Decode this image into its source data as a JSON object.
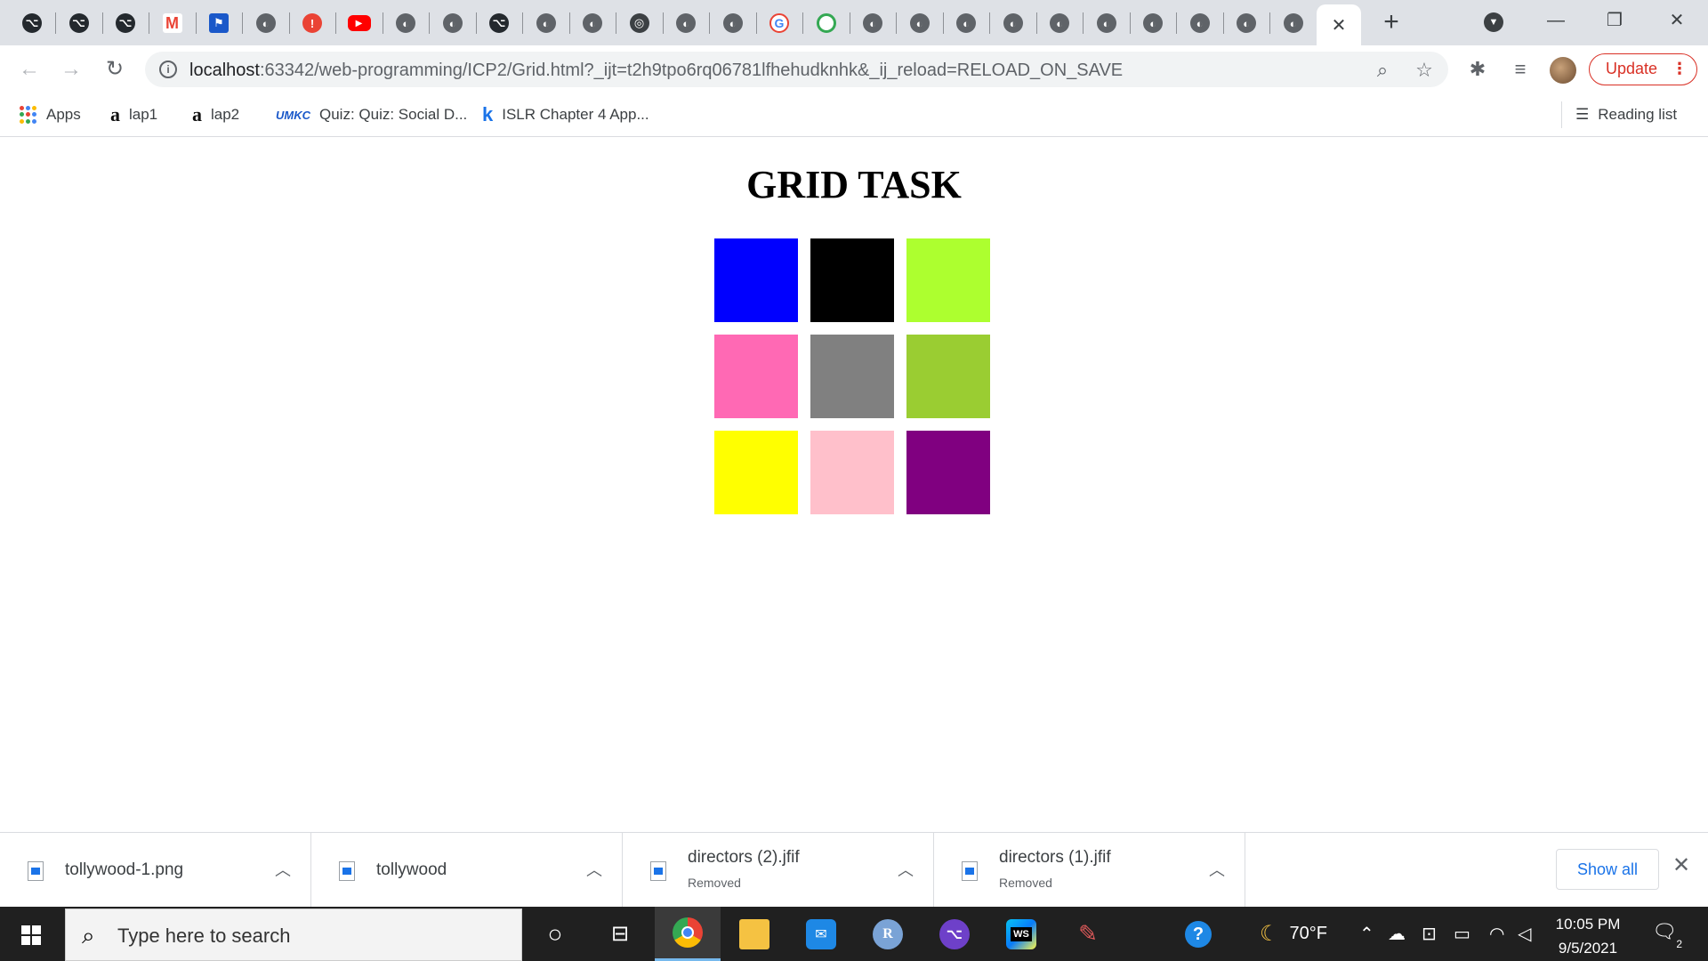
{
  "browser": {
    "tabs": [
      {
        "icon": "github-icon",
        "glyph": "⌥"
      },
      {
        "icon": "github-icon",
        "glyph": "⌥"
      },
      {
        "icon": "github-icon",
        "glyph": "⌥"
      },
      {
        "icon": "gmail-icon",
        "glyph": "M"
      },
      {
        "icon": "flag-icon",
        "glyph": "⚑"
      },
      {
        "icon": "globe-icon",
        "glyph": "◐"
      },
      {
        "icon": "alert-icon",
        "glyph": "!"
      },
      {
        "icon": "youtube-icon",
        "glyph": "▶"
      },
      {
        "icon": "globe-icon",
        "glyph": "◐"
      },
      {
        "icon": "globe-icon",
        "glyph": "◐"
      },
      {
        "icon": "github-icon",
        "glyph": "⌥"
      },
      {
        "icon": "globe-icon",
        "glyph": "◐"
      },
      {
        "icon": "globe-icon",
        "glyph": "◐"
      },
      {
        "icon": "chromium-icon",
        "glyph": "◎"
      },
      {
        "icon": "globe-icon",
        "glyph": "◐"
      },
      {
        "icon": "globe-icon",
        "glyph": "◐"
      },
      {
        "icon": "google-icon",
        "glyph": "G"
      },
      {
        "icon": "google-meet-icon",
        "glyph": ""
      },
      {
        "icon": "globe-icon",
        "glyph": "◐"
      },
      {
        "icon": "globe-icon",
        "glyph": "◐"
      },
      {
        "icon": "globe-icon",
        "glyph": "◐"
      },
      {
        "icon": "globe-icon",
        "glyph": "◐"
      },
      {
        "icon": "globe-icon",
        "glyph": "◐"
      },
      {
        "icon": "globe-icon",
        "glyph": "◐"
      },
      {
        "icon": "globe-icon",
        "glyph": "◐"
      },
      {
        "icon": "globe-icon",
        "glyph": "◐"
      },
      {
        "icon": "globe-icon",
        "glyph": "◐"
      },
      {
        "icon": "globe-icon",
        "glyph": "◐"
      }
    ],
    "url_host": "localhost",
    "url_rest": ":63342/web-programming/ICP2/Grid.html?_ijt=t2h9tpo6rq06781lfhehudknhk&_ij_reload=RELOAD_ON_SAVE",
    "update_label": "Update",
    "bookmarks": {
      "apps": "Apps",
      "lap1": "lap1",
      "lap2": "lap2",
      "quiz": "Quiz: Quiz: Social D...",
      "umkc_logo": "UMKC",
      "islr": "ISLR Chapter 4 App...",
      "reading_list": "Reading list"
    }
  },
  "page": {
    "title": "GRID TASK",
    "colors": [
      "#0000ff",
      "#000000",
      "#adff2f",
      "#ff69b4",
      "#808080",
      "#9acd32",
      "#ffff00",
      "#ffc0cb",
      "#800080"
    ]
  },
  "downloads": {
    "items": [
      {
        "name": "tollywood-1.png",
        "status": ""
      },
      {
        "name": "tollywood",
        "status": ""
      },
      {
        "name": "directors (2).jfif",
        "status": "Removed"
      },
      {
        "name": "directors (1).jfif",
        "status": "Removed"
      }
    ],
    "show_all": "Show all"
  },
  "taskbar": {
    "search_placeholder": "Type here to search",
    "weather": "70°F",
    "time": "10:05 PM",
    "date": "9/5/2021",
    "notification_count": "2"
  }
}
